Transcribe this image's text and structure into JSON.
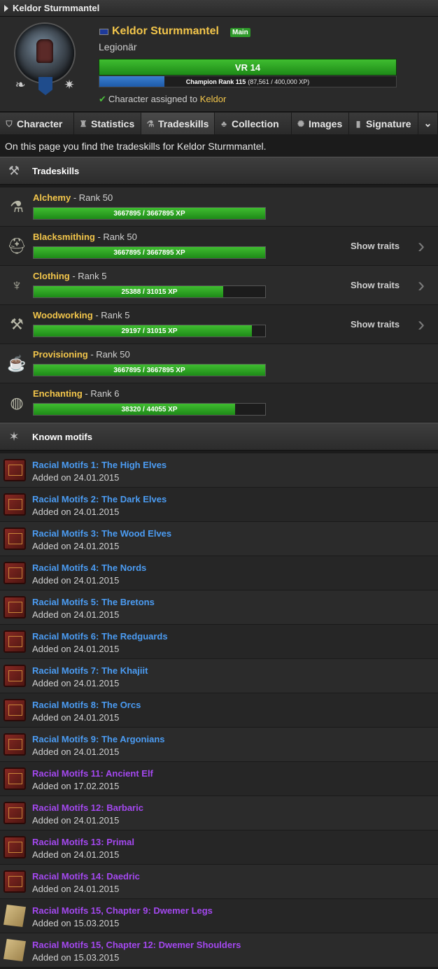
{
  "window": {
    "title": "Keldor Sturmmantel"
  },
  "profile": {
    "name": "Keldor Sturmmantel",
    "main_badge": "Main",
    "class_title": "Legionär",
    "vr_label": "VR 14",
    "champion": {
      "label": "Champion Rank 115",
      "detail": "(87,561 / 400,000 XP)",
      "progress": 0.219
    },
    "assigned_text": "Character assigned to",
    "assigned_to": "Keldor",
    "icons": [
      "avatar",
      "dragon-emblem-icon",
      "alliance-shield-icon",
      "sunburst-emblem-icon",
      "flag-icon",
      "check-icon"
    ]
  },
  "tabs": [
    {
      "label": "Character",
      "icon": "shield-icon",
      "active": false
    },
    {
      "label": "Statistics",
      "icon": "trophy-icon",
      "active": false
    },
    {
      "label": "Tradeskills",
      "icon": "flask-icon",
      "active": true
    },
    {
      "label": "Collection",
      "icon": "collection-icon",
      "active": false
    },
    {
      "label": "Images",
      "icon": "images-icon",
      "active": false
    },
    {
      "label": "Signature",
      "icon": "signature-icon",
      "active": false
    }
  ],
  "intro": "On this page you find the tradeskills for Keldor Sturmmantel.",
  "tradeskills": {
    "heading": "Tradeskills",
    "items": [
      {
        "name": "Alchemy",
        "rank": " - Rank 50",
        "xp": "3667895 / 3667895 XP",
        "progress": 1.0,
        "traits": "",
        "icon": "alchemy-icon"
      },
      {
        "name": "Blacksmithing",
        "rank": " - Rank 50",
        "xp": "3667895 / 3667895 XP",
        "progress": 1.0,
        "traits": "Show traits",
        "icon": "blacksmithing-icon"
      },
      {
        "name": "Clothing",
        "rank": " - Rank 5",
        "xp": "25388 / 31015 XP",
        "progress": 0.8186,
        "traits": "Show traits",
        "icon": "clothing-icon"
      },
      {
        "name": "Woodworking",
        "rank": " - Rank 5",
        "xp": "29197 / 31015 XP",
        "progress": 0.9414,
        "traits": "Show traits",
        "icon": "woodworking-icon"
      },
      {
        "name": "Provisioning",
        "rank": " - Rank 50",
        "xp": "3667895 / 3667895 XP",
        "progress": 1.0,
        "traits": "",
        "icon": "provisioning-icon"
      },
      {
        "name": "Enchanting",
        "rank": " - Rank 6",
        "xp": "38320 / 44055 XP",
        "progress": 0.8698,
        "traits": "",
        "icon": "enchanting-icon"
      }
    ]
  },
  "motifs": {
    "heading": "Known motifs",
    "items": [
      {
        "title": "Racial Motifs 1: The High Elves",
        "date": "Added on 24.01.2015",
        "color": "#4b9cf3",
        "icon": "book-icon"
      },
      {
        "title": "Racial Motifs 2: The Dark Elves",
        "date": "Added on 24.01.2015",
        "color": "#4b9cf3",
        "icon": "book-icon"
      },
      {
        "title": "Racial Motifs 3: The Wood Elves",
        "date": "Added on 24.01.2015",
        "color": "#4b9cf3",
        "icon": "book-icon"
      },
      {
        "title": "Racial Motifs 4: The Nords",
        "date": "Added on 24.01.2015",
        "color": "#4b9cf3",
        "icon": "book-icon"
      },
      {
        "title": "Racial Motifs 5: The Bretons",
        "date": "Added on 24.01.2015",
        "color": "#4b9cf3",
        "icon": "book-icon"
      },
      {
        "title": "Racial Motifs 6: The Redguards",
        "date": "Added on 24.01.2015",
        "color": "#4b9cf3",
        "icon": "book-icon"
      },
      {
        "title": "Racial Motifs 7: The Khajiit",
        "date": "Added on 24.01.2015",
        "color": "#4b9cf3",
        "icon": "book-icon"
      },
      {
        "title": "Racial Motifs 8: The Orcs",
        "date": "Added on 24.01.2015",
        "color": "#4b9cf3",
        "icon": "book-icon"
      },
      {
        "title": "Racial Motifs 9: The Argonians",
        "date": "Added on 24.01.2015",
        "color": "#4b9cf3",
        "icon": "book-icon"
      },
      {
        "title": "Racial Motifs 11: Ancient Elf",
        "date": "Added on 17.02.2015",
        "color": "#a448f0",
        "icon": "book-icon"
      },
      {
        "title": "Racial Motifs 12: Barbaric",
        "date": "Added on 24.01.2015",
        "color": "#a448f0",
        "icon": "book-icon"
      },
      {
        "title": "Racial Motifs 13: Primal",
        "date": "Added on 24.01.2015",
        "color": "#a448f0",
        "icon": "book-icon"
      },
      {
        "title": "Racial Motifs 14: Daedric",
        "date": "Added on 24.01.2015",
        "color": "#a448f0",
        "icon": "book-icon"
      },
      {
        "title": "Racial Motifs 15, Chapter 9: Dwemer Legs",
        "date": "Added on 15.03.2015",
        "color": "#a448f0",
        "icon": "scroll-icon"
      },
      {
        "title": "Racial Motifs 15, Chapter 12: Dwemer Shoulders",
        "date": "Added on 15.03.2015",
        "color": "#a448f0",
        "icon": "scroll-icon"
      }
    ]
  }
}
